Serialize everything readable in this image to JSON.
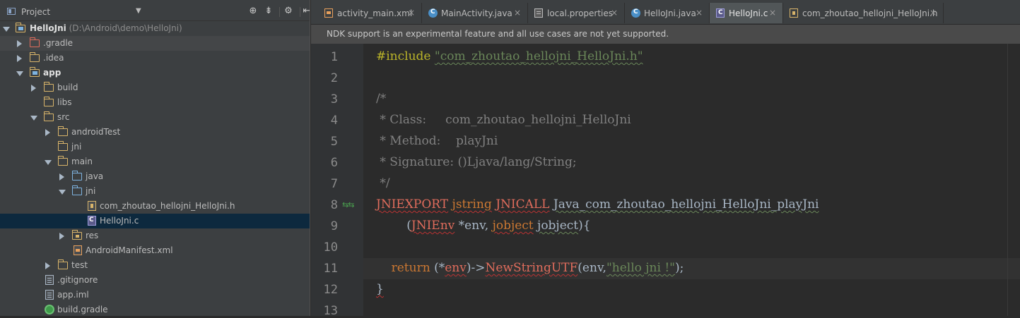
{
  "project_pane": {
    "title": "Project",
    "tree": [
      {
        "name": "HelloJni",
        "path": "(D:\\Android\\demo\\HelloJni)",
        "icon": "module-icon"
      },
      {
        "name": ".gradle",
        "icon": "folder-icon"
      },
      {
        "name": ".idea",
        "icon": "folder-icon"
      },
      {
        "name": "app",
        "icon": "module-folder-icon"
      },
      {
        "name": "build",
        "icon": "folder-icon"
      },
      {
        "name": "libs",
        "icon": "folder-icon"
      },
      {
        "name": "src",
        "icon": "folder-icon"
      },
      {
        "name": "androidTest",
        "icon": "folder-icon"
      },
      {
        "name": "jni",
        "icon": "folder-icon"
      },
      {
        "name": "main",
        "icon": "folder-icon"
      },
      {
        "name": "java",
        "icon": "source-folder-icon"
      },
      {
        "name": "jni",
        "icon": "source-folder-icon"
      },
      {
        "name": "com_zhoutao_hellojni_HelloJni.h",
        "icon": "header-file-icon"
      },
      {
        "name": "HelloJni.c",
        "icon": "c-file-icon"
      },
      {
        "name": "res",
        "icon": "resource-folder-icon"
      },
      {
        "name": "AndroidManifest.xml",
        "icon": "xml-file-icon"
      },
      {
        "name": "test",
        "icon": "folder-icon"
      },
      {
        "name": ".gitignore",
        "icon": "text-file-icon"
      },
      {
        "name": "app.iml",
        "icon": "iml-file-icon"
      },
      {
        "name": "build.gradle",
        "icon": "gradle-icon"
      }
    ]
  },
  "tabs": [
    {
      "label": "activity_main.xml",
      "icon": "xml-file-icon"
    },
    {
      "label": "MainActivity.java",
      "icon": "java-class-icon"
    },
    {
      "label": "local.properties",
      "icon": "properties-file-icon"
    },
    {
      "label": "HelloJni.java",
      "icon": "java-class-icon"
    },
    {
      "label": "HelloJni.c",
      "icon": "c-file-icon"
    },
    {
      "label": "com_zhoutao_hellojni_HelloJni.h",
      "icon": "header-file-icon"
    }
  ],
  "close_glyph": "×",
  "notice": "NDK support is an experimental feature and all use cases are not yet supported.",
  "editor": {
    "line_numbers": [
      "1",
      "2",
      "3",
      "4",
      "5",
      "6",
      "7",
      "8",
      "9",
      "10",
      "11",
      "12",
      "13"
    ],
    "code": {
      "l1_directive": "#include",
      "l1_string": "\"com_zhoutao_hellojni_HelloJni.h\"",
      "l3": "/*",
      "l4": " * Class:     com_zhoutao_hellojni_HelloJni",
      "l5": " * Method:    playJni",
      "l6": " * Signature: ()Ljava/lang/String;",
      "l7": " */",
      "l8_macro1": "JNIEXPORT",
      "l8_type": "jstring",
      "l8_macro2": "JNICALL",
      "l8_name": "Java_com_zhoutao_hellojni_HelloJni_playJni",
      "l9_indent": "        (",
      "l9_type1": "JNIEnv",
      "l9_mid": " *env, ",
      "l9_type2": "jobject",
      "l9_param": "jobject",
      "l9_end": "){",
      "l11_kw": "return",
      "l11_a": "(*",
      "l11_env": "env",
      "l11_b": ")->",
      "l11_fn": "NewStringUTF",
      "l11_c": "(env,",
      "l11_str": "\"hello jni !\"",
      "l11_d": ");",
      "l12": "}"
    }
  }
}
